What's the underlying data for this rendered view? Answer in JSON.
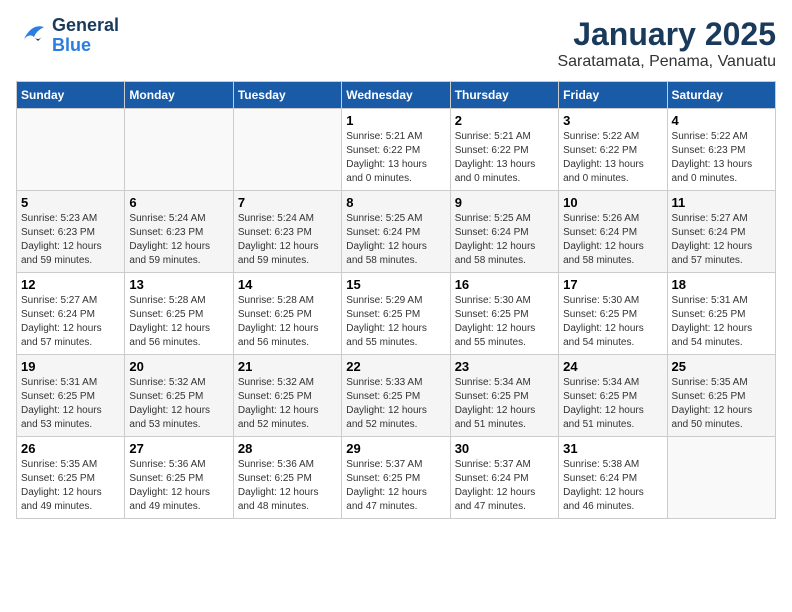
{
  "header": {
    "logo_general": "General",
    "logo_blue": "Blue",
    "month_year": "January 2025",
    "location": "Saratamata, Penama, Vanuatu"
  },
  "days_of_week": [
    "Sunday",
    "Monday",
    "Tuesday",
    "Wednesday",
    "Thursday",
    "Friday",
    "Saturday"
  ],
  "weeks": [
    [
      {
        "day": "",
        "info": ""
      },
      {
        "day": "",
        "info": ""
      },
      {
        "day": "",
        "info": ""
      },
      {
        "day": "1",
        "info": "Sunrise: 5:21 AM\nSunset: 6:22 PM\nDaylight: 13 hours\nand 0 minutes."
      },
      {
        "day": "2",
        "info": "Sunrise: 5:21 AM\nSunset: 6:22 PM\nDaylight: 13 hours\nand 0 minutes."
      },
      {
        "day": "3",
        "info": "Sunrise: 5:22 AM\nSunset: 6:22 PM\nDaylight: 13 hours\nand 0 minutes."
      },
      {
        "day": "4",
        "info": "Sunrise: 5:22 AM\nSunset: 6:23 PM\nDaylight: 13 hours\nand 0 minutes."
      }
    ],
    [
      {
        "day": "5",
        "info": "Sunrise: 5:23 AM\nSunset: 6:23 PM\nDaylight: 12 hours\nand 59 minutes."
      },
      {
        "day": "6",
        "info": "Sunrise: 5:24 AM\nSunset: 6:23 PM\nDaylight: 12 hours\nand 59 minutes."
      },
      {
        "day": "7",
        "info": "Sunrise: 5:24 AM\nSunset: 6:23 PM\nDaylight: 12 hours\nand 59 minutes."
      },
      {
        "day": "8",
        "info": "Sunrise: 5:25 AM\nSunset: 6:24 PM\nDaylight: 12 hours\nand 58 minutes."
      },
      {
        "day": "9",
        "info": "Sunrise: 5:25 AM\nSunset: 6:24 PM\nDaylight: 12 hours\nand 58 minutes."
      },
      {
        "day": "10",
        "info": "Sunrise: 5:26 AM\nSunset: 6:24 PM\nDaylight: 12 hours\nand 58 minutes."
      },
      {
        "day": "11",
        "info": "Sunrise: 5:27 AM\nSunset: 6:24 PM\nDaylight: 12 hours\nand 57 minutes."
      }
    ],
    [
      {
        "day": "12",
        "info": "Sunrise: 5:27 AM\nSunset: 6:24 PM\nDaylight: 12 hours\nand 57 minutes."
      },
      {
        "day": "13",
        "info": "Sunrise: 5:28 AM\nSunset: 6:25 PM\nDaylight: 12 hours\nand 56 minutes."
      },
      {
        "day": "14",
        "info": "Sunrise: 5:28 AM\nSunset: 6:25 PM\nDaylight: 12 hours\nand 56 minutes."
      },
      {
        "day": "15",
        "info": "Sunrise: 5:29 AM\nSunset: 6:25 PM\nDaylight: 12 hours\nand 55 minutes."
      },
      {
        "day": "16",
        "info": "Sunrise: 5:30 AM\nSunset: 6:25 PM\nDaylight: 12 hours\nand 55 minutes."
      },
      {
        "day": "17",
        "info": "Sunrise: 5:30 AM\nSunset: 6:25 PM\nDaylight: 12 hours\nand 54 minutes."
      },
      {
        "day": "18",
        "info": "Sunrise: 5:31 AM\nSunset: 6:25 PM\nDaylight: 12 hours\nand 54 minutes."
      }
    ],
    [
      {
        "day": "19",
        "info": "Sunrise: 5:31 AM\nSunset: 6:25 PM\nDaylight: 12 hours\nand 53 minutes."
      },
      {
        "day": "20",
        "info": "Sunrise: 5:32 AM\nSunset: 6:25 PM\nDaylight: 12 hours\nand 53 minutes."
      },
      {
        "day": "21",
        "info": "Sunrise: 5:32 AM\nSunset: 6:25 PM\nDaylight: 12 hours\nand 52 minutes."
      },
      {
        "day": "22",
        "info": "Sunrise: 5:33 AM\nSunset: 6:25 PM\nDaylight: 12 hours\nand 52 minutes."
      },
      {
        "day": "23",
        "info": "Sunrise: 5:34 AM\nSunset: 6:25 PM\nDaylight: 12 hours\nand 51 minutes."
      },
      {
        "day": "24",
        "info": "Sunrise: 5:34 AM\nSunset: 6:25 PM\nDaylight: 12 hours\nand 51 minutes."
      },
      {
        "day": "25",
        "info": "Sunrise: 5:35 AM\nSunset: 6:25 PM\nDaylight: 12 hours\nand 50 minutes."
      }
    ],
    [
      {
        "day": "26",
        "info": "Sunrise: 5:35 AM\nSunset: 6:25 PM\nDaylight: 12 hours\nand 49 minutes."
      },
      {
        "day": "27",
        "info": "Sunrise: 5:36 AM\nSunset: 6:25 PM\nDaylight: 12 hours\nand 49 minutes."
      },
      {
        "day": "28",
        "info": "Sunrise: 5:36 AM\nSunset: 6:25 PM\nDaylight: 12 hours\nand 48 minutes."
      },
      {
        "day": "29",
        "info": "Sunrise: 5:37 AM\nSunset: 6:25 PM\nDaylight: 12 hours\nand 47 minutes."
      },
      {
        "day": "30",
        "info": "Sunrise: 5:37 AM\nSunset: 6:24 PM\nDaylight: 12 hours\nand 47 minutes."
      },
      {
        "day": "31",
        "info": "Sunrise: 5:38 AM\nSunset: 6:24 PM\nDaylight: 12 hours\nand 46 minutes."
      },
      {
        "day": "",
        "info": ""
      }
    ]
  ]
}
